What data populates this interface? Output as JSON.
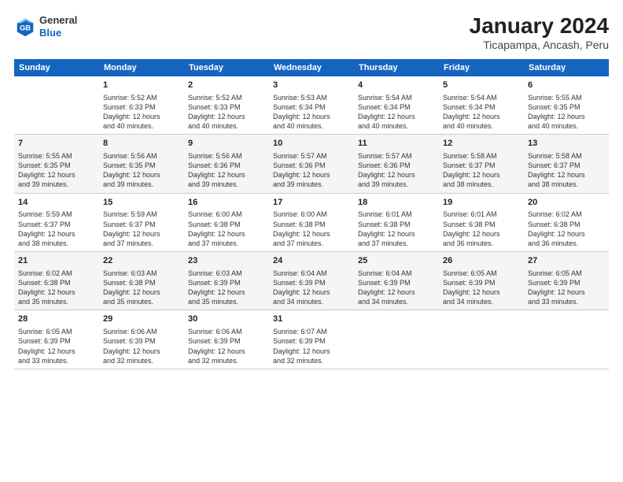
{
  "header": {
    "logo_general": "General",
    "logo_blue": "Blue",
    "main_title": "January 2024",
    "subtitle": "Ticapampa, Ancash, Peru"
  },
  "calendar": {
    "days_of_week": [
      "Sunday",
      "Monday",
      "Tuesday",
      "Wednesday",
      "Thursday",
      "Friday",
      "Saturday"
    ],
    "weeks": [
      [
        {
          "day": "",
          "info": ""
        },
        {
          "day": "1",
          "info": "Sunrise: 5:52 AM\nSunset: 6:33 PM\nDaylight: 12 hours\nand 40 minutes."
        },
        {
          "day": "2",
          "info": "Sunrise: 5:52 AM\nSunset: 6:33 PM\nDaylight: 12 hours\nand 40 minutes."
        },
        {
          "day": "3",
          "info": "Sunrise: 5:53 AM\nSunset: 6:34 PM\nDaylight: 12 hours\nand 40 minutes."
        },
        {
          "day": "4",
          "info": "Sunrise: 5:54 AM\nSunset: 6:34 PM\nDaylight: 12 hours\nand 40 minutes."
        },
        {
          "day": "5",
          "info": "Sunrise: 5:54 AM\nSunset: 6:34 PM\nDaylight: 12 hours\nand 40 minutes."
        },
        {
          "day": "6",
          "info": "Sunrise: 5:55 AM\nSunset: 6:35 PM\nDaylight: 12 hours\nand 40 minutes."
        }
      ],
      [
        {
          "day": "7",
          "info": "Sunrise: 5:55 AM\nSunset: 6:35 PM\nDaylight: 12 hours\nand 39 minutes."
        },
        {
          "day": "8",
          "info": "Sunrise: 5:56 AM\nSunset: 6:35 PM\nDaylight: 12 hours\nand 39 minutes."
        },
        {
          "day": "9",
          "info": "Sunrise: 5:56 AM\nSunset: 6:36 PM\nDaylight: 12 hours\nand 39 minutes."
        },
        {
          "day": "10",
          "info": "Sunrise: 5:57 AM\nSunset: 6:36 PM\nDaylight: 12 hours\nand 39 minutes."
        },
        {
          "day": "11",
          "info": "Sunrise: 5:57 AM\nSunset: 6:36 PM\nDaylight: 12 hours\nand 39 minutes."
        },
        {
          "day": "12",
          "info": "Sunrise: 5:58 AM\nSunset: 6:37 PM\nDaylight: 12 hours\nand 38 minutes."
        },
        {
          "day": "13",
          "info": "Sunrise: 5:58 AM\nSunset: 6:37 PM\nDaylight: 12 hours\nand 38 minutes."
        }
      ],
      [
        {
          "day": "14",
          "info": "Sunrise: 5:59 AM\nSunset: 6:37 PM\nDaylight: 12 hours\nand 38 minutes."
        },
        {
          "day": "15",
          "info": "Sunrise: 5:59 AM\nSunset: 6:37 PM\nDaylight: 12 hours\nand 37 minutes."
        },
        {
          "day": "16",
          "info": "Sunrise: 6:00 AM\nSunset: 6:38 PM\nDaylight: 12 hours\nand 37 minutes."
        },
        {
          "day": "17",
          "info": "Sunrise: 6:00 AM\nSunset: 6:38 PM\nDaylight: 12 hours\nand 37 minutes."
        },
        {
          "day": "18",
          "info": "Sunrise: 6:01 AM\nSunset: 6:38 PM\nDaylight: 12 hours\nand 37 minutes."
        },
        {
          "day": "19",
          "info": "Sunrise: 6:01 AM\nSunset: 6:38 PM\nDaylight: 12 hours\nand 36 minutes."
        },
        {
          "day": "20",
          "info": "Sunrise: 6:02 AM\nSunset: 6:38 PM\nDaylight: 12 hours\nand 36 minutes."
        }
      ],
      [
        {
          "day": "21",
          "info": "Sunrise: 6:02 AM\nSunset: 6:38 PM\nDaylight: 12 hours\nand 35 minutes."
        },
        {
          "day": "22",
          "info": "Sunrise: 6:03 AM\nSunset: 6:38 PM\nDaylight: 12 hours\nand 35 minutes."
        },
        {
          "day": "23",
          "info": "Sunrise: 6:03 AM\nSunset: 6:39 PM\nDaylight: 12 hours\nand 35 minutes."
        },
        {
          "day": "24",
          "info": "Sunrise: 6:04 AM\nSunset: 6:39 PM\nDaylight: 12 hours\nand 34 minutes."
        },
        {
          "day": "25",
          "info": "Sunrise: 6:04 AM\nSunset: 6:39 PM\nDaylight: 12 hours\nand 34 minutes."
        },
        {
          "day": "26",
          "info": "Sunrise: 6:05 AM\nSunset: 6:39 PM\nDaylight: 12 hours\nand 34 minutes."
        },
        {
          "day": "27",
          "info": "Sunrise: 6:05 AM\nSunset: 6:39 PM\nDaylight: 12 hours\nand 33 minutes."
        }
      ],
      [
        {
          "day": "28",
          "info": "Sunrise: 6:05 AM\nSunset: 6:39 PM\nDaylight: 12 hours\nand 33 minutes."
        },
        {
          "day": "29",
          "info": "Sunrise: 6:06 AM\nSunset: 6:39 PM\nDaylight: 12 hours\nand 32 minutes."
        },
        {
          "day": "30",
          "info": "Sunrise: 6:06 AM\nSunset: 6:39 PM\nDaylight: 12 hours\nand 32 minutes."
        },
        {
          "day": "31",
          "info": "Sunrise: 6:07 AM\nSunset: 6:39 PM\nDaylight: 12 hours\nand 32 minutes."
        },
        {
          "day": "",
          "info": ""
        },
        {
          "day": "",
          "info": ""
        },
        {
          "day": "",
          "info": ""
        }
      ]
    ]
  }
}
